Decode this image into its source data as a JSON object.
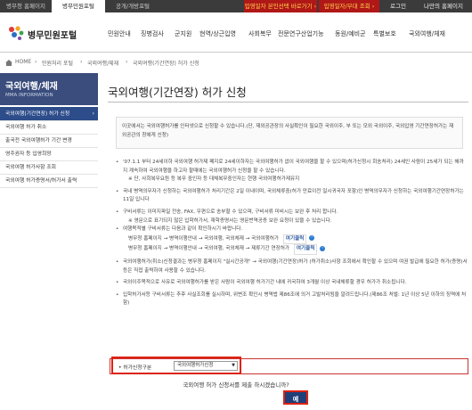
{
  "topbar": {
    "tabs": [
      "병무청 홈페이지",
      "병무민원포털",
      "공개/개방포털"
    ],
    "red_tabs": [
      "입영일자 본인선택 바로가기 ›",
      "입영일자/부대 조회 ›"
    ],
    "utils": [
      "로그인",
      "나만의 홈페이지"
    ]
  },
  "header": {
    "logo_text": "병무민원포털",
    "nav": [
      "민원안내",
      "징병검사",
      "군지원",
      "현역/상근입영",
      "사회복무",
      "전문연구산업기능",
      "동원/예비군",
      "특별보호",
      "국외여행/체재"
    ]
  },
  "breadcrumb": [
    "HOME",
    "›",
    "민원처리 포털",
    "›",
    "국외여행/체재",
    "›",
    "국외여행(기간연장) 허가 신청"
  ],
  "sidebar": {
    "title": "국외여행/체재",
    "subtitle": "MMA INFORMATION",
    "items": [
      {
        "label": "국외여행(기간연장) 허가 신청",
        "active": true
      },
      {
        "label": "국외여행 허가 취소",
        "active": false
      },
      {
        "label": "출국전 국외여행허가 기간 변경",
        "active": false
      },
      {
        "label": "영주권자 등 입영희망",
        "active": false
      },
      {
        "label": "국외여행 허가사항 조회",
        "active": false
      },
      {
        "label": "국외여행 허가증명서/허가서 출력",
        "active": false
      }
    ]
  },
  "main": {
    "title": "국외여행(기간연장) 허가 신청",
    "intro": "이곳에서는 국외여행허가를 인터넷으로 신청할 수 있습니다.(단, 재외공관장의 사실확인이 필요한 국외이주, 부 또는 모외 국외이주, 국외입영 기간연장허가는 재외공관의 창에게 신청)",
    "paragraphs": [
      "'07.1.1 부터 24세이하 국외여행 허가제 폐지로 24세이하자는 국외여행허가 없이 국외여행을 할 수 있으며(허가신청시 회송처리) 24세인 사람이 25세가 되는 해까지 계속하여 국외여행을 하고자 할때에는 국외여행허가 신청을 할 수 있습니다.",
      "※ 단, 사회복무요원 등 복무 중인자 등 대체복무중인자는 현행 국외여행허가제유지",
      "국내 병역의무자가 신청하는 국외여행허가 처리기간은 2일 이내이며, 국외체류중(허가 만료이전 일시귀국자 포함)인 병역의무자가 신청하는 국외여행기간연장허가는 11일 입니다",
      "구비서류는 이미지파일 전송, FAX, 우편으로 송부할 수 있으며, 구비서류 미비시는 보완 후 처리 합니다.",
      "※ 영문으로 표기되지 않은 입학허가서, 재학증명서는 영문번역공증 보완 요청이 있을 수 있습니다.",
      "여행목적별 구비서류는 다음과 같이 확인하시기 바랍니다.",
      "병무청 홈페이지 → 병역이행안내 → 국외여행, 국외체재 → 국외여행허가",
      "병무청 홈페이지 → 병역이행안내 → 국외여행, 국외체재 → 제류기간 연장허가",
      "국외여행허가(취소)신청결과는 병무청 홈페이지 \"실시간공개\" → 국외여행(기간연장)허가 (허가취소)사항 조회에서 확인할 수 있으며 여권 발급에 필요한 허가(증명)서 등은 직접 출력하여 사용할 수 있습니다.",
      "국외이주목적으로 사유로 국외여행허가를 받은 사람이 국외여행 허가기간 내에 귀국하여 3개월 이상 국내체류할 경우 허가가 취소됩니다.",
      "입학허가서등 구비서류는 추후 사실조회를 실시하며, 위변조 확인시 병역법 제86조에 의거 고발처리됨을 알려드립니다.(제86조 처벌: 1년 이상 5년 이하의 징역에 처함)"
    ],
    "link_label": "여기클릭",
    "form": {
      "label": "• 허가신청구분",
      "select_value": "국외여행허가신청"
    },
    "confirm_text": "국외여행 허가 신청서를 제출 하시겠습니까?",
    "yes_label": "예"
  },
  "colors": {
    "sidebar_active": "#2d4c8a",
    "sidebar_title": "#3a4d7c",
    "red_tab": "#b01717",
    "primary_button": "#1f3f7a",
    "highlight_border": "#d21"
  }
}
